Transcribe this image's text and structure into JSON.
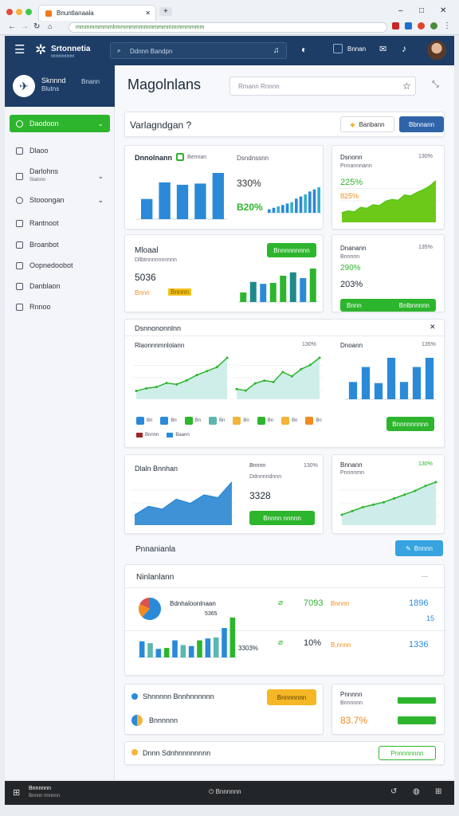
{
  "browser": {
    "tab_title": "Bnuntlanaala",
    "url": "mmmmmmmmlrmmmmmmmmmmmmmmmmmmm",
    "search_placeholder": "Ddnnn Bandpn"
  },
  "app": {
    "brand": "Srtonnetia",
    "brand_sub": "ttttttttttttttttttttt",
    "nav_label": "Bnnan"
  },
  "sidebar": {
    "profile_name": "Sknnnd",
    "profile_sub": "Blutns",
    "profile_extra": "Bnann",
    "items": [
      {
        "label": "Daodoon",
        "active": true
      },
      {
        "label": "Dlaoo"
      },
      {
        "label": "Darlohns",
        "sub": "Slatonn"
      },
      {
        "label": "Stooongan"
      },
      {
        "label": "Rantnoot"
      },
      {
        "label": "Broanbot"
      },
      {
        "label": "Oopnedoobot"
      },
      {
        "label": "Danblaon"
      },
      {
        "label": "Rnnoo"
      }
    ]
  },
  "header": {
    "title": "Magolnlans",
    "search_placeholder": "Rmann Rnnnn"
  },
  "section1": {
    "title": "Varlagndgan ?",
    "btn1": "Banbann",
    "btn2": "Bbnnann"
  },
  "card1": {
    "title": "Dnnolnann",
    "subtitle": "Bennan",
    "pct": "330%",
    "pct2": "B20%",
    "sub2": "Dsndnssnn",
    "bars": [
      34,
      62,
      58,
      60,
      78
    ],
    "bars2": [
      10,
      14,
      18,
      22,
      26,
      30,
      40,
      46,
      52,
      60,
      66,
      72
    ]
  },
  "card2": {
    "title": "Dsnonn",
    "subtitle": "Pnnannnann",
    "right": "130%",
    "pct": "225%",
    "pct2": "825%",
    "area": [
      18,
      22,
      20,
      30,
      28,
      36,
      34,
      44,
      48,
      46,
      58,
      56,
      64,
      70,
      78,
      90
    ]
  },
  "card3": {
    "title": "Mloaal",
    "sub": "Dllbtnnnnnnnnnn",
    "pct": "5036",
    "label_a": "Bnnn",
    "label_b": "Bnnnn",
    "btn": "Bnnnnnnnnn",
    "bars": [
      20,
      42,
      38,
      40,
      55,
      62,
      50,
      70
    ]
  },
  "card4": {
    "title": "Dnanann",
    "sub": "Bnnnnn",
    "right": "135%",
    "pct": "290%",
    "pct2": "203%",
    "btn_a": "Bnnn",
    "btn_b": "Bnlbnnnnn"
  },
  "card5": {
    "title": "Dsnnononnlnn",
    "chart_a_title": "Rlaonnnmnlolann",
    "chart_a_right": "130%",
    "chart_b_title": "Dnoann",
    "chart_b_right": "135%",
    "btn": "Bnnnnnnnnn",
    "line_a": [
      10,
      14,
      16,
      22,
      20,
      26,
      34,
      40,
      46,
      60
    ],
    "line_b": [
      12,
      10,
      20,
      24,
      22,
      36,
      30,
      40,
      46,
      56
    ],
    "bars": [
      30,
      56,
      28,
      72,
      30,
      56,
      72
    ],
    "legend": [
      "Bn",
      "Bn",
      "Bn",
      "Bn",
      "Bn",
      "Bn",
      "Bn",
      "Bn"
    ],
    "legend2": [
      "Bnnnn",
      "Baann"
    ]
  },
  "card6": {
    "title": "Dlaln Bnnhan",
    "sub": "Bnnnn",
    "sub2": "Ddnnnndnnn",
    "right": "130%",
    "pct": "3328",
    "btn": "Bnnnn nnnnn",
    "area": [
      12,
      24,
      20,
      34,
      28,
      40,
      36,
      58
    ]
  },
  "card7": {
    "title": "Bnnann",
    "sub": "Pnnnnmn",
    "right": "130%",
    "line": [
      14,
      20,
      26,
      30,
      34,
      40,
      46,
      52,
      60,
      66
    ]
  },
  "section2": {
    "title": "Pnnanianla",
    "btn": "Bnnnn"
  },
  "card8": {
    "title": "Ninlanlann",
    "row1_label": "Bdnhaloonlnaan",
    "row1_value": "5365",
    "row1_num": "7093",
    "row1_tag": "Bnnnn",
    "row1_pct": "1896",
    "row1_extra": "15",
    "row2_pct": "3303%",
    "row2_num": "10%",
    "row2_tag": "B,nnnn",
    "row2_pct2": "1336",
    "bars": [
      34,
      30,
      18,
      20,
      36,
      26,
      24,
      36,
      40,
      42,
      62,
      84
    ]
  },
  "card9": {
    "title": "Shnnnnn Bnnhnnnnnn",
    "sub": "Bnnnnnn",
    "btn": "Bnnnnnnn"
  },
  "card10": {
    "title": "Pnnnnn",
    "sub": "Bnnnnnn",
    "pct": "83.7%"
  },
  "card11": {
    "title": "Dnnn Sdnhnnnnnnnn",
    "btn": "Pnnnnnnnn"
  },
  "taskbar": {
    "label": "Bnnnnnn",
    "sub": "Bnnnn nnnnnn",
    "center": "Bnnnnnn"
  },
  "colors": {
    "nav": "#1d3d66",
    "green": "#2db52d",
    "blue": "#2f64a8",
    "lime": "#6cc91a",
    "teal": "#5bb7b0"
  }
}
